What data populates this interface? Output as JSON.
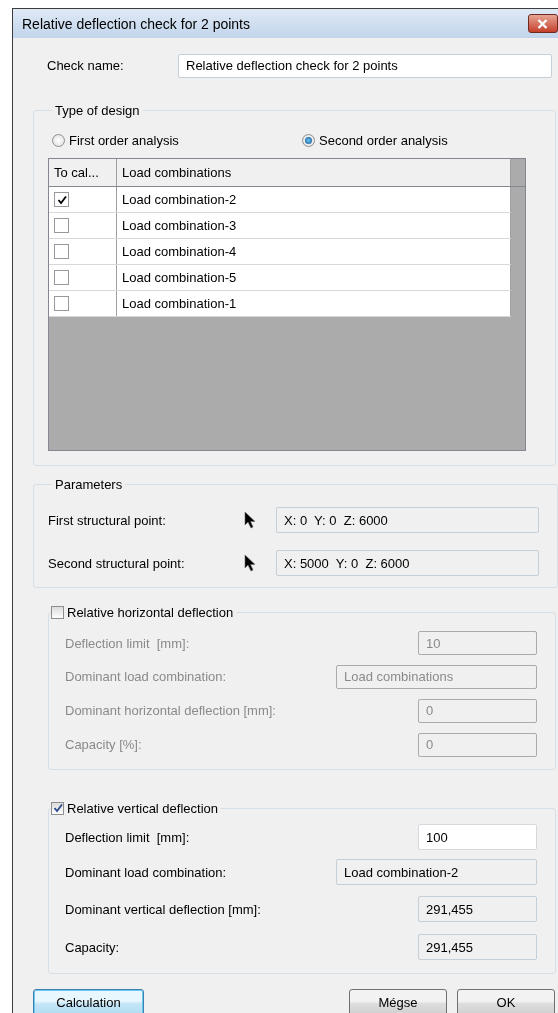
{
  "window": {
    "title": "Relative deflection check for 2 points"
  },
  "check_name": {
    "label": "Check name:",
    "value": "Relative deflection check for 2 points"
  },
  "type_of_design": {
    "title": "Type of design",
    "options": [
      {
        "label": "First order analysis",
        "selected": false
      },
      {
        "label": "Second order analysis",
        "selected": true
      }
    ],
    "table": {
      "columns": [
        "To cal...",
        "Load combinations"
      ],
      "rows": [
        {
          "checked": true,
          "name": "Load combination-2"
        },
        {
          "checked": false,
          "name": "Load combination-3"
        },
        {
          "checked": false,
          "name": "Load combination-4"
        },
        {
          "checked": false,
          "name": "Load combination-5"
        },
        {
          "checked": false,
          "name": "Load combination-1"
        }
      ]
    }
  },
  "parameters": {
    "title": "Parameters",
    "points": [
      {
        "label": "First structural point:",
        "value": "X: 0  Y: 0  Z: 6000"
      },
      {
        "label": "Second structural point:",
        "value": "X: 5000  Y: 0  Z: 6000"
      }
    ]
  },
  "horizontal": {
    "title": "Relative horizontal deflection",
    "checked": false,
    "fields": [
      {
        "kind": "input",
        "label": "Deflection limit  [mm]:",
        "value": "10"
      },
      {
        "kind": "combo",
        "label": "Dominant load combination:",
        "value": "Load combinations"
      },
      {
        "kind": "readonly",
        "label": "Dominant horizontal deflection [mm]:",
        "value": "0"
      },
      {
        "kind": "readonly",
        "label": "Capacity [%]:",
        "value": "0"
      }
    ]
  },
  "vertical": {
    "title": "Relative vertical deflection",
    "checked": true,
    "fields": [
      {
        "kind": "input",
        "label": "Deflection limit  [mm]:",
        "value": "100"
      },
      {
        "kind": "combo",
        "label": "Dominant load combination:",
        "value": "Load combination-2"
      },
      {
        "kind": "readonly",
        "label": "Dominant vertical deflection [mm]:",
        "value": "291,455"
      },
      {
        "kind": "readonly",
        "label": "Capacity:",
        "value": "291,455"
      }
    ]
  },
  "buttons": [
    {
      "kind": "default",
      "label": "Calculation"
    },
    {
      "kind": "normal",
      "label": "Mégse"
    },
    {
      "kind": "normal",
      "label": "OK"
    }
  ]
}
